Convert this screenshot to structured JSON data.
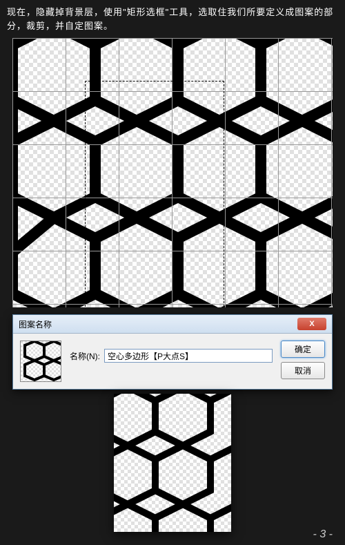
{
  "instruction": "现在，隐藏掉背景层，使用\"矩形选框\"工具，选取住我们所要定义成图案的部分，裁剪，并自定图案。",
  "dialog": {
    "title": "图案名称",
    "close": "X",
    "name_label": "名称(N):",
    "name_value": "空心多边形【P大点S】",
    "ok": "确定",
    "cancel": "取消"
  },
  "page_number": "- 3 -"
}
